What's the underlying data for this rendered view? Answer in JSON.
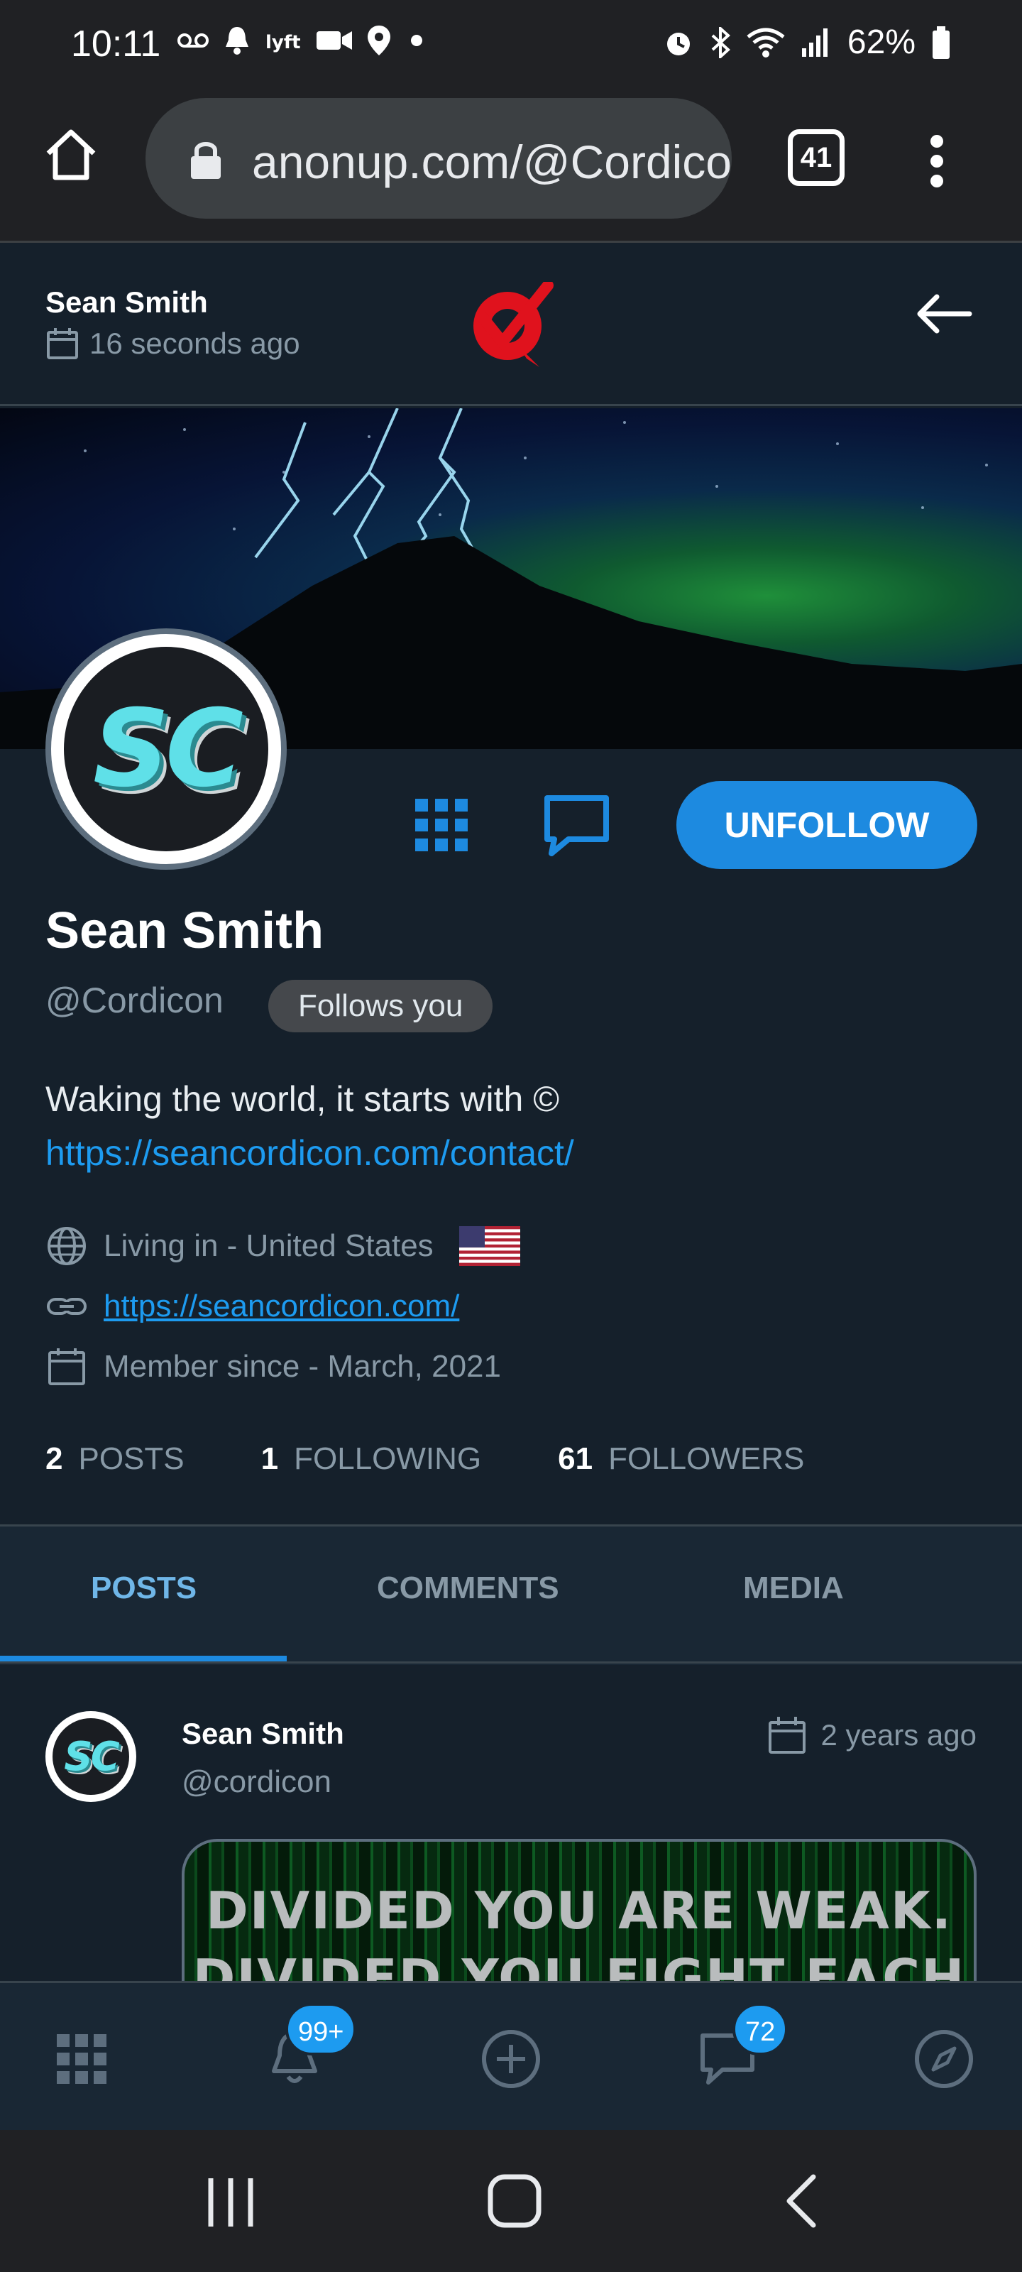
{
  "status_bar": {
    "time": "10:11",
    "battery": "62%",
    "left_icons": [
      "voicemail-icon",
      "bell-icon",
      "lyft-icon",
      "video-icon",
      "location-icon",
      "dot-icon"
    ],
    "right_icons": [
      "alarm-icon",
      "bluetooth-icon",
      "wifi-icon",
      "signal-icon",
      "battery-icon"
    ]
  },
  "browser": {
    "url": "anonup.com/@Cordicon",
    "tab_count": "41"
  },
  "page_header": {
    "name": "Sean Smith",
    "time": "16 seconds ago"
  },
  "profile": {
    "avatar_initials": "SC",
    "unfollow_label": "UNFOLLOW",
    "name": "Sean Smith",
    "handle": "@Cordicon",
    "follows_badge": "Follows you",
    "bio_text": "Waking the world, it starts with ©",
    "bio_link": "https://seancordicon.com/contact/",
    "location": "Living in - United States",
    "website": "https://seancordicon.com/",
    "member_since": "Member since - March, 2021"
  },
  "stats": [
    {
      "count": "2",
      "label": "POSTS"
    },
    {
      "count": "1",
      "label": "FOLLOWING"
    },
    {
      "count": "61",
      "label": "FOLLOWERS"
    }
  ],
  "tabs": [
    {
      "label": "POSTS",
      "active": true
    },
    {
      "label": "COMMENTS",
      "active": false
    },
    {
      "label": "MEDIA",
      "active": false
    }
  ],
  "post": {
    "name": "Sean Smith",
    "handle": "@cordicon",
    "time": "2 years ago",
    "avatar_initials": "SC",
    "media_line1": "DIVIDED YOU ARE WEAK.",
    "media_line2": "DIVIDED YOU FIGHT EACH OTHER"
  },
  "bottom_nav": {
    "notifications_badge": "99+",
    "messages_badge": "72",
    "items": [
      "apps-icon",
      "bell-icon",
      "add-circle-icon",
      "chat-icon",
      "compass-icon"
    ]
  },
  "colors": {
    "background": "#15202b",
    "accent": "#1d8ae0",
    "muted": "#8899a6"
  }
}
